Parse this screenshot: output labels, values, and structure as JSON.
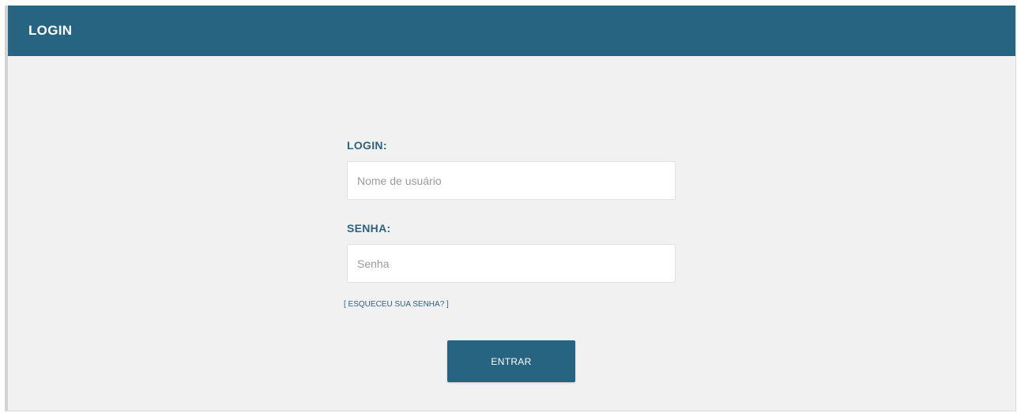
{
  "header": {
    "title": "LOGIN"
  },
  "form": {
    "login_label": "LOGIN:",
    "login_placeholder": "Nome de usuário",
    "login_value": "",
    "password_label": "SENHA:",
    "password_placeholder": "Senha",
    "password_value": "",
    "forgot_link": "[ ESQUECEU SUA SENHA? ]",
    "submit_label": "ENTRAR"
  },
  "colors": {
    "primary": "#276482",
    "label": "#2d6283",
    "background": "#f1f1f1"
  }
}
